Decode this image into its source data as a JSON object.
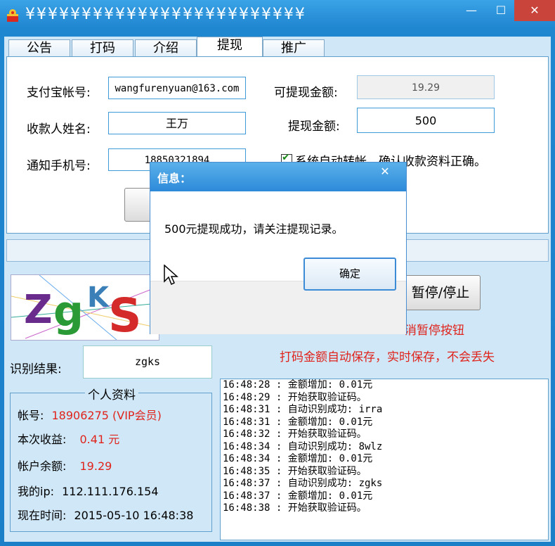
{
  "window": {
    "title": "¥¥¥¥¥¥¥¥¥¥¥¥¥¥¥¥¥¥¥¥¥¥¥¥¥",
    "minimize": "—",
    "maximize": "☐",
    "close": "✕"
  },
  "tabs": [
    {
      "label": "公告"
    },
    {
      "label": "打码"
    },
    {
      "label": "介绍"
    },
    {
      "label": "提现",
      "active": true
    },
    {
      "label": "推广"
    }
  ],
  "withdraw": {
    "alipay_label": "支付宝帐号:",
    "alipay_value": "wangfurenyuan@163.com",
    "name_label": "收款人姓名:",
    "name_value": "王万",
    "phone_label": "通知手机号:",
    "phone_value": "18850321894",
    "available_label": "可提现金额:",
    "available_value": "19.29",
    "amount_label": "提现金额:",
    "amount_value": "500",
    "confirm_text": "系统自动转帐，确认收款资料正确。"
  },
  "captcha": {
    "text": "ZgkS"
  },
  "controls": {
    "pause_button": "暂停/停止",
    "cancel_pause_hint": "消暂停按钮",
    "autosave_note": "打码金额自动保存，实时保存，不会丢失",
    "result_label": "识别结果:",
    "result_value": "zgks"
  },
  "profile": {
    "title": "个人资料",
    "account_label": "帐号:",
    "account_value": "18906275 (VIP会员)",
    "earnings_label": "本次收益:",
    "earnings_value": "0.41  元",
    "balance_label": "帐户余额:",
    "balance_value": "19.29",
    "ip_label": "我的ip:",
    "ip_value": "112.111.176.154",
    "time_label": "现在时间:",
    "time_value": "2015-05-10 16:48:38"
  },
  "log": [
    "16:48:28 : 金额增加: 0.01元",
    "16:48:29 : 开始获取验证码。",
    "16:48:31 : 自动识别成功: irra",
    "16:48:31 : 金额增加: 0.01元",
    "16:48:32 : 开始获取验证码。",
    "16:48:34 : 自动识别成功: 8wlz",
    "16:48:34 : 金额增加: 0.01元",
    "16:48:35 : 开始获取验证码。",
    "16:48:37 : 自动识别成功: zgks",
    "16:48:37 : 金额增加: 0.01元",
    "16:48:38 : 开始获取验证码。"
  ],
  "dialog": {
    "title": "信息：",
    "close": "✕",
    "message": "500元提现成功，请关注提现记录。",
    "ok": "确定"
  }
}
